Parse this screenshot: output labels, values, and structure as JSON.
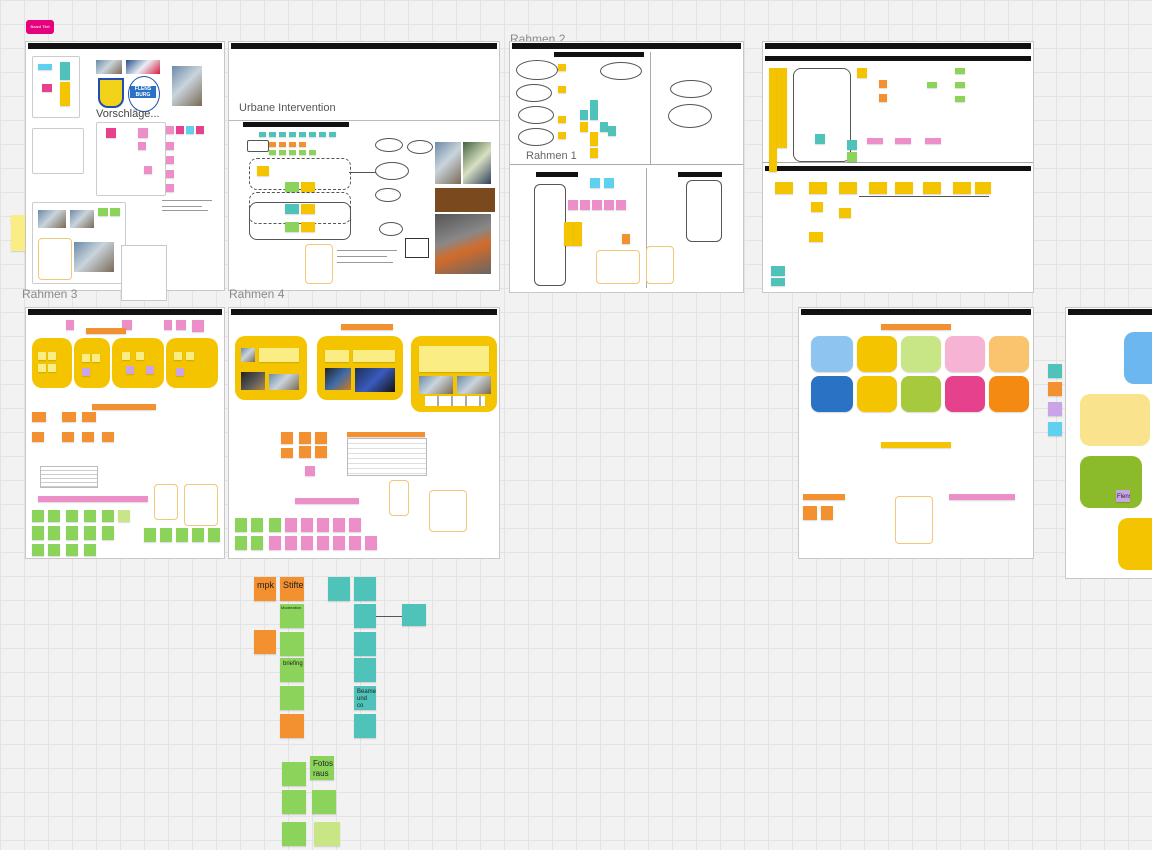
{
  "board": {
    "tag_label": "Board Titel",
    "frames": {
      "rahmen2": "Rahmen 2",
      "rahmen1": "Rahmen 1",
      "rahmen3": "Rahmen 3",
      "rahmen4": "Rahmen 4"
    },
    "inner_texts": {
      "vorschlaege": "Vorschläge...",
      "urbane": "Urbane Intervention"
    },
    "stickies_bottom": {
      "mpk": "mpk",
      "stifte": "Stifte",
      "moderation": "Moderation",
      "briefing": "briefing",
      "fotos": "Fotos raus",
      "beamer": "Beamer und co"
    },
    "fenster_label": "Flens"
  },
  "colors": {
    "accent": "#e6007e",
    "sticky_yellow": "#f5c400",
    "sticky_orange": "#f3902f",
    "sticky_green": "#8bd35a",
    "sticky_teal": "#4fc2b9"
  }
}
